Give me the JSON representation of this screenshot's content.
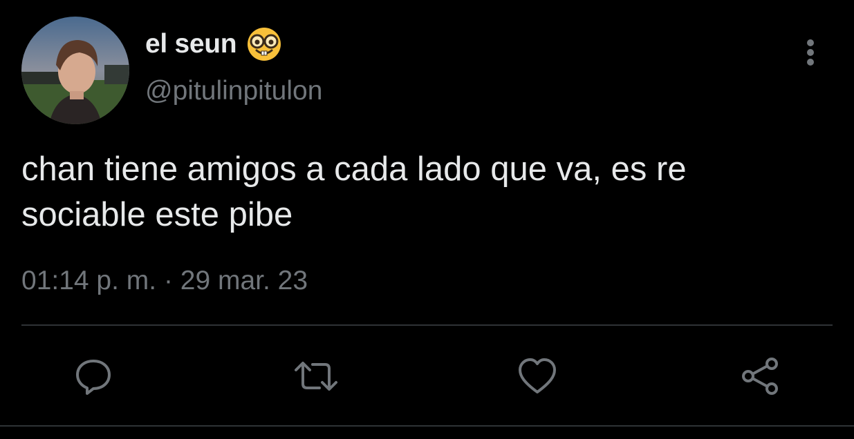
{
  "tweet": {
    "author": {
      "display_name": "el seun",
      "emoji_icon": "nerd-face-icon",
      "handle": "@pitulinpitulon",
      "avatar": "avatar"
    },
    "text_line_1": "chan tiene amigos a cada lado que va, es re",
    "text_line_2": "sociable este pibe",
    "timestamp": "01:14 p. m. · 29 mar. 23"
  },
  "actions": [
    {
      "name": "reply",
      "icon": "comment-bubble-icon"
    },
    {
      "name": "retweet",
      "icon": "retweet-icon"
    },
    {
      "name": "like",
      "icon": "heart-icon"
    },
    {
      "name": "share",
      "icon": "share-icon"
    }
  ],
  "menu_icon": "more-vertical-icon",
  "colors": {
    "background": "#000000",
    "primary_text": "#e7e9ea",
    "secondary_text": "#71767b",
    "divider": "#2f3336"
  }
}
